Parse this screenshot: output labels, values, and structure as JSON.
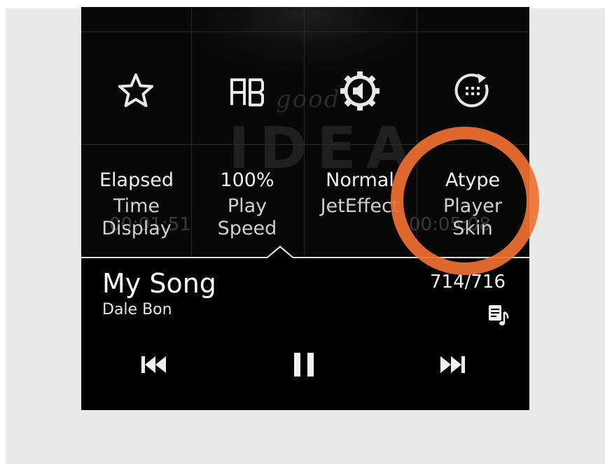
{
  "menu": {
    "items": [
      {
        "icon": "star-icon",
        "line1": "Elapsed",
        "line2": "Time",
        "line3": "Display"
      },
      {
        "icon": "ab-repeat-icon",
        "line1": "100%",
        "line2": "Play",
        "line3": "Speed"
      },
      {
        "icon": "audio-settings-gear-icon",
        "line1": "Normal",
        "line2": "JetEffect",
        "line3": ""
      },
      {
        "icon": "skin-refresh-icon",
        "line1": "Atype",
        "line2": "Player",
        "line3": "Skin"
      }
    ]
  },
  "background": {
    "art_word_small": "good",
    "art_word_large": "IDEA",
    "time_left": "00:01:51",
    "time_right": "00:05:08"
  },
  "now_playing": {
    "title": "My Song",
    "artist": "Dale Bon",
    "track_position": "714/716"
  },
  "controls": {
    "previous": "previous-icon",
    "pause": "pause-icon",
    "next": "next-icon"
  },
  "colors": {
    "highlight": "#f07030",
    "player_bg": "#000000",
    "outer_bg": "#e9e9e9"
  }
}
